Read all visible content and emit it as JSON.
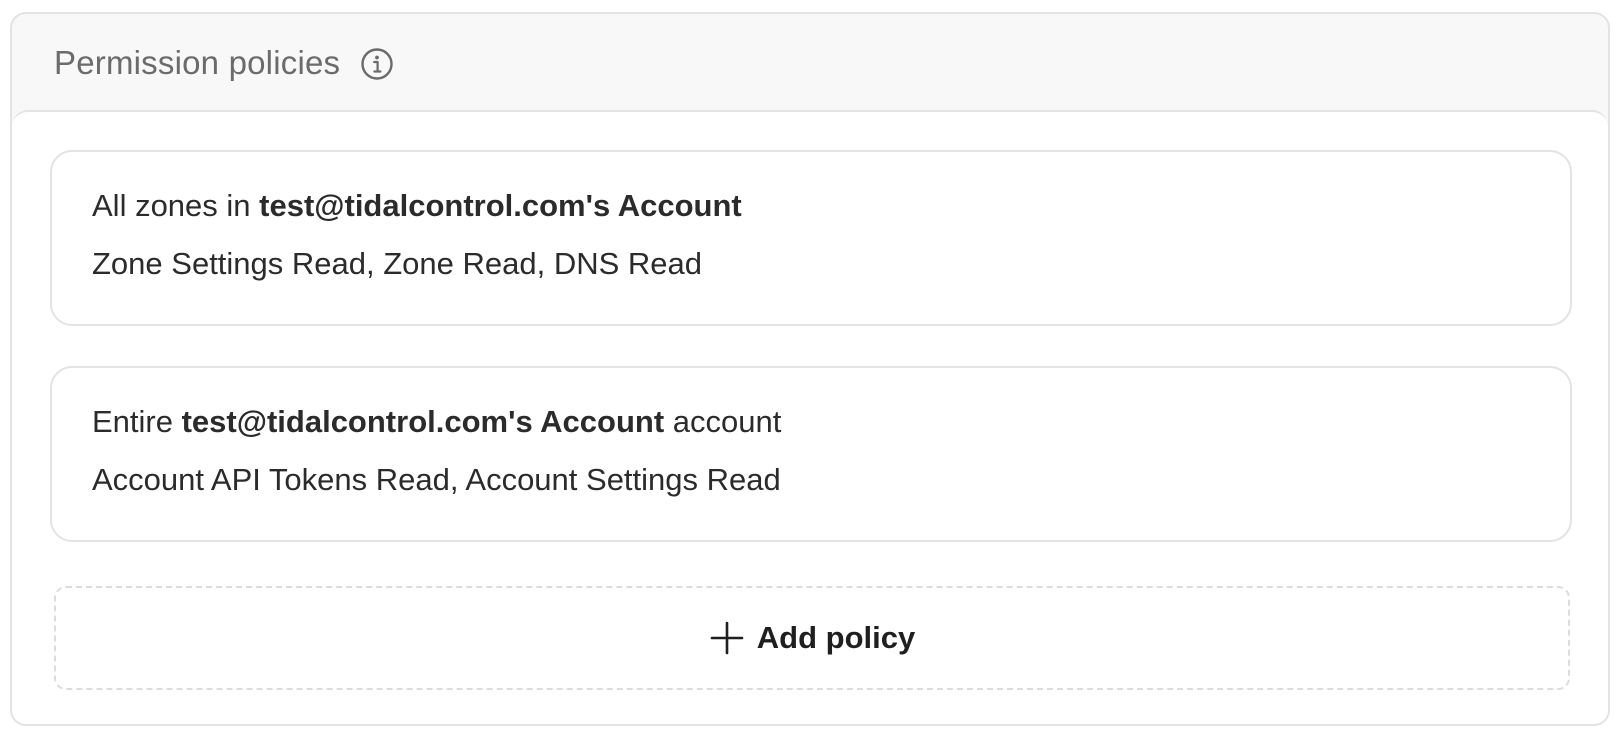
{
  "panel": {
    "title": "Permission policies",
    "info_icon": "info-icon"
  },
  "policies": [
    {
      "scope_prefix": "All zones in ",
      "scope_bold": "test@tidalcontrol.com's Account",
      "scope_suffix": "",
      "permissions": "Zone Settings Read, Zone Read, DNS Read"
    },
    {
      "scope_prefix": "Entire ",
      "scope_bold": "test@tidalcontrol.com's Account",
      "scope_suffix": " account",
      "permissions": "Account API Tokens Read, Account Settings Read"
    }
  ],
  "add_policy": {
    "label": "Add policy",
    "icon": "plus-icon"
  }
}
